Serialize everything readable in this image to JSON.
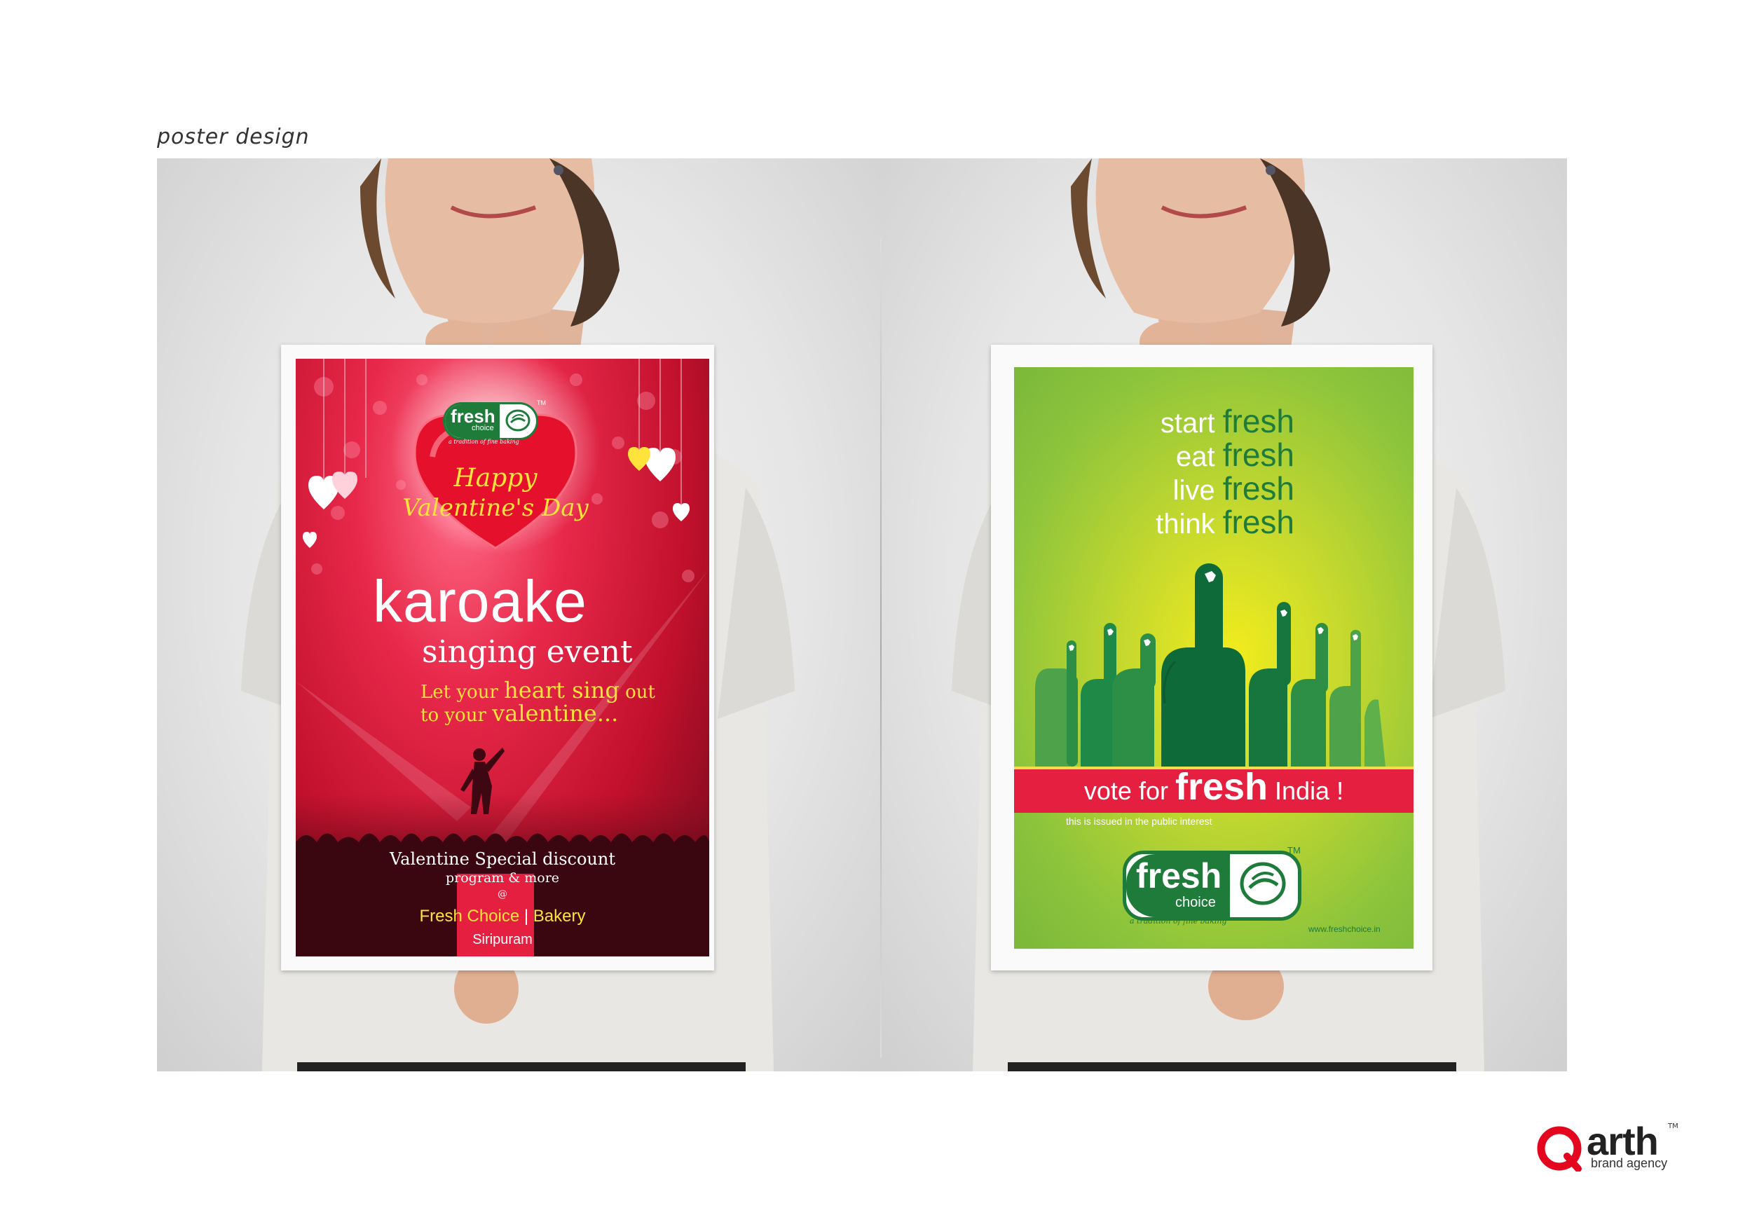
{
  "page": {
    "section_label": "poster design"
  },
  "poster_left": {
    "logo_fresh": "fresh",
    "logo_choice": "choice",
    "logo_tagline": "a tradition of fine baking",
    "logo_tm": "TM",
    "heart_line1": "Happy",
    "heart_line2": "Valentine's Day",
    "title": "karoake",
    "subtitle": "singing event",
    "tagline_1a": "Let your ",
    "tagline_1b": "heart sing",
    "tagline_1c": " out",
    "tagline_2a": "to your ",
    "tagline_2b": "valentine...",
    "offer_line1": "Valentine Special discount",
    "offer_line2": "program & more",
    "offer_at": "@",
    "venue_a": "Fresh Choice",
    "venue_sep": " | ",
    "venue_b": "Bakery",
    "location": "Siripuram"
  },
  "poster_right": {
    "line1_a": "start ",
    "line1_b": "fresh",
    "line2_a": "eat ",
    "line2_b": "fresh",
    "line3_a": "live ",
    "line3_b": "fresh",
    "line4_a": "think ",
    "line4_b": "fresh",
    "banner_a": "vote for ",
    "banner_b": "fresh",
    "banner_c": " India !",
    "notice": "this is issued in the public interest",
    "logo_fresh": "fresh",
    "logo_choice": "choice",
    "logo_tagline": "a tradition of fine baking",
    "logo_tm": "TM",
    "website": "www.freshchoice.in"
  },
  "agency_logo": {
    "name": "arth",
    "tagline": "brand agency",
    "tm": "TM"
  },
  "colors": {
    "red_poster": "#d81b3c",
    "green_poster": "#8cc43c",
    "brand_green": "#1e7b3a",
    "accent_yellow": "#ffe23a",
    "banner_red": "#e51f3f"
  }
}
